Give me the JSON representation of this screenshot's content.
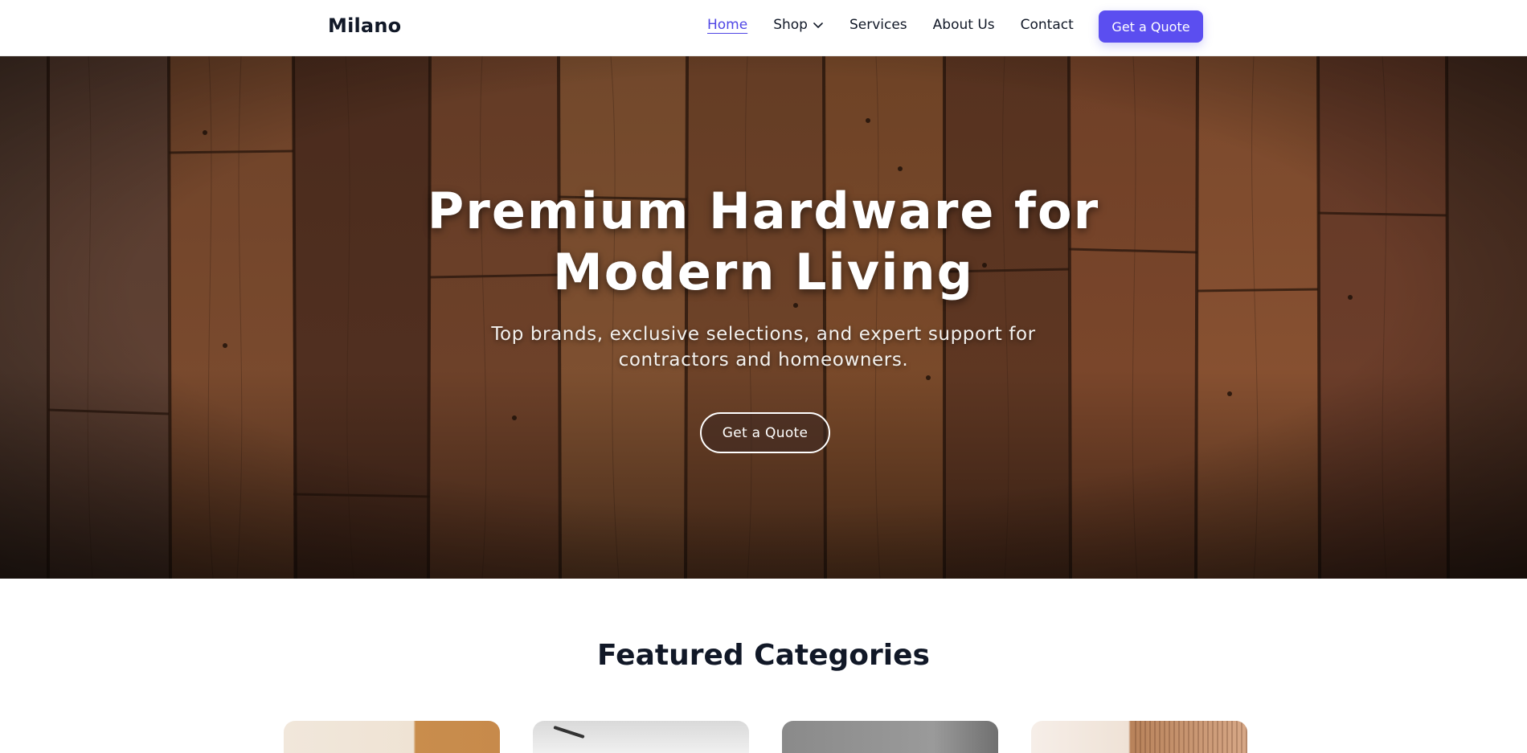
{
  "brand": "Milano",
  "nav": {
    "items": [
      {
        "label": "Home"
      },
      {
        "label": "Shop"
      },
      {
        "label": "Services"
      },
      {
        "label": "About Us"
      },
      {
        "label": "Contact"
      }
    ],
    "cta_label": "Get a Quote"
  },
  "hero": {
    "title_line1": "Premium Hardware for",
    "title_line2": "Modern Living",
    "subtitle": "Top brands, exclusive selections, and expert support for contractors and homeowners.",
    "cta_label": "Get a Quote"
  },
  "featured": {
    "title": "Featured Categories"
  },
  "colors": {
    "accent": "#5b4ef0",
    "nav_active": "#4f46e5",
    "text": "#111827",
    "wood": "#6b3a22"
  },
  "icons": {
    "shop_dropdown": "chevron-down-icon"
  }
}
